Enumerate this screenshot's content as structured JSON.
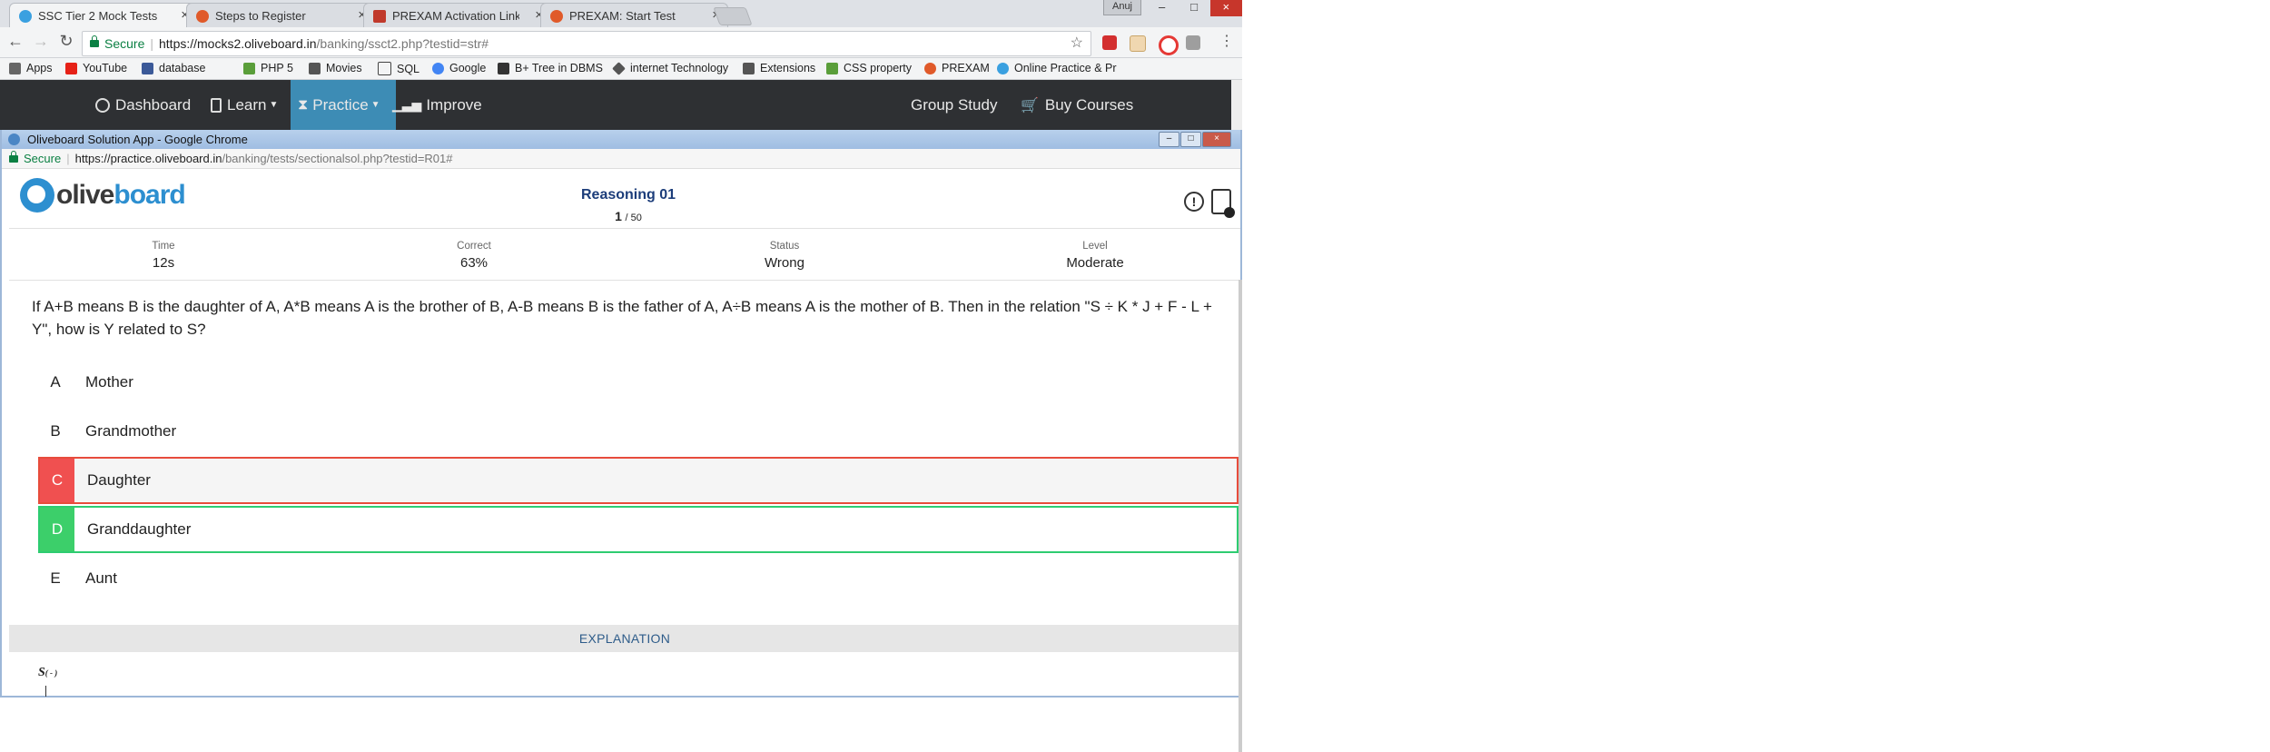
{
  "browser": {
    "tabs": [
      {
        "title": "SSC Tier 2 Mock Tests",
        "favicon_color": "#3aa0e0",
        "active": true
      },
      {
        "title": "Steps to Register",
        "favicon_color": "#e05a2a",
        "active": false
      },
      {
        "title": "PREXAM Activation Link",
        "favicon_color": "#c0392b",
        "active": false
      },
      {
        "title": "PREXAM: Start Test",
        "favicon_color": "#e05a2a",
        "active": false
      }
    ],
    "user_name": "Anuj",
    "secure_label": "Secure",
    "url_host": "https://mocks2.oliveboard.in",
    "url_path": "/banking/ssct2.php?testid=str#",
    "bookmarks": [
      {
        "label": "Apps",
        "icon": "apps-grid-icon",
        "color": "#666"
      },
      {
        "label": "YouTube",
        "icon": "youtube-icon",
        "color": "#e62117"
      },
      {
        "label": "database",
        "icon": "facebook-icon",
        "color": "#3b5998"
      },
      {
        "label": "PHP 5",
        "icon": "php-icon",
        "color": "#5a9e3a"
      },
      {
        "label": "Movies",
        "icon": "movies-icon",
        "color": "#555"
      },
      {
        "label": "SQL",
        "icon": "text-icon",
        "color": "#444"
      },
      {
        "label": "Google",
        "icon": "google-icon",
        "color": "#4285f4"
      },
      {
        "label": "B+ Tree in DBMS",
        "icon": "site-icon",
        "color": "#333"
      },
      {
        "label": "internet Technology",
        "icon": "diamond-icon",
        "color": "#555"
      },
      {
        "label": "Extensions",
        "icon": "puzzle-icon",
        "color": "#555"
      },
      {
        "label": "CSS property",
        "icon": "css-icon",
        "color": "#5a9e3a"
      },
      {
        "label": "PREXAM",
        "icon": "prexam-icon",
        "color": "#e05a2a"
      },
      {
        "label": "Online Practice & Pr",
        "icon": "oliveboard-icon",
        "color": "#3aa0e0"
      }
    ]
  },
  "site_nav": {
    "items": [
      {
        "label": "Dashboard"
      },
      {
        "label": "Learn"
      },
      {
        "label": "Practice"
      },
      {
        "label": "Improve"
      }
    ],
    "right_items": [
      {
        "label": "Group Study"
      },
      {
        "label": "Buy Courses"
      }
    ]
  },
  "popup": {
    "window_title": "Oliveboard Solution App - Google Chrome",
    "secure_label": "Secure",
    "url_host": "https://practice.oliveboard.in",
    "url_path": "/banking/tests/sectionalsol.php?testid=R01#"
  },
  "header": {
    "logo_olive": "olive",
    "logo_board": "board",
    "title": "Reasoning 01",
    "current_q": "1",
    "total_q": "/ 50"
  },
  "stats": [
    {
      "label": "Time",
      "value": "12s"
    },
    {
      "label": "Correct",
      "value": "63%"
    },
    {
      "label": "Status",
      "value": "Wrong"
    },
    {
      "label": "Level",
      "value": "Moderate"
    }
  ],
  "question": {
    "text": "If A+B means B is the daughter of A, A*B means A is the brother of B, A-B means B is the father of A, A÷B means A is the mother of B. Then in the relation \"S ÷ K * J + F - L + Y\", how is Y related to S?",
    "options": [
      {
        "letter": "A",
        "text": "Mother",
        "state": "normal"
      },
      {
        "letter": "B",
        "text": "Grandmother",
        "state": "normal"
      },
      {
        "letter": "C",
        "text": "Daughter",
        "state": "wrong"
      },
      {
        "letter": "D",
        "text": "Granddaughter",
        "state": "correct"
      },
      {
        "letter": "E",
        "text": "Aunt",
        "state": "normal"
      }
    ]
  },
  "explanation": {
    "heading": "EXPLANATION",
    "snippet_main": "S",
    "snippet_sub": "( - )"
  }
}
